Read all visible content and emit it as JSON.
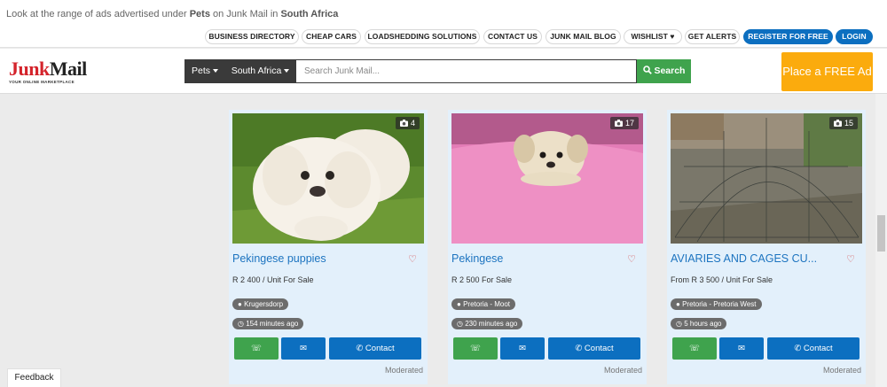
{
  "top_notice": {
    "prefix": "Look at the range of ads advertised under ",
    "category": "Pets",
    "middle": " on Junk Mail in ",
    "region": "South Africa"
  },
  "nav": {
    "links": [
      "BUSINESS DIRECTORY",
      "CHEAP CARS",
      "LOADSHEDDING SOLUTIONS",
      "CONTACT US",
      "JUNK MAIL BLOG",
      "WISHLIST ♥",
      "GET ALERTS"
    ],
    "register": "REGISTER FOR FREE",
    "login": "LOGIN"
  },
  "logo": {
    "part1": "Junk",
    "part2": "Mail",
    "tagline": "YOUR ONLINE MARKETPLACE"
  },
  "search": {
    "category": "Pets",
    "region": "South Africa",
    "placeholder": "Search Junk Mail...",
    "button": "Search"
  },
  "place_ad": "Place a FREE Ad",
  "listings": [
    {
      "photo_count": "4",
      "title": "Pekingese puppies",
      "price": "R 2 400 / Unit For Sale",
      "location": "Krugersdorp",
      "posted": "154 minutes ago",
      "contact": "Contact",
      "status": "Moderated"
    },
    {
      "photo_count": "17",
      "title": "Pekingese",
      "price": "R 2 500 For Sale",
      "location": "Pretoria - Moot",
      "posted": "230 minutes ago",
      "contact": "Contact",
      "status": "Moderated"
    },
    {
      "photo_count": "15",
      "title": "AVIARIES AND CAGES CU...",
      "price": "From R 3 500 / Unit For Sale",
      "location": "Pretoria - Pretoria West",
      "posted": "5 hours ago",
      "contact": "Contact",
      "status": "Moderated"
    }
  ],
  "feedback": "Feedback"
}
